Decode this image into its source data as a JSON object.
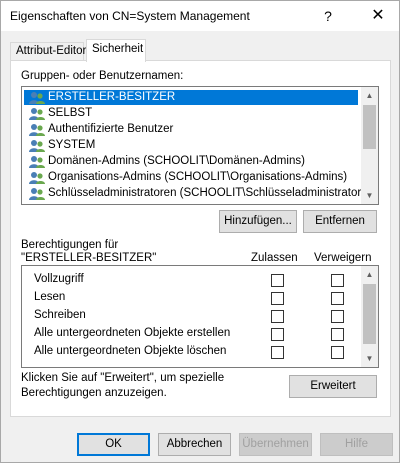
{
  "window": {
    "title": "Eigenschaften von CN=System Management",
    "help_symbol": "?",
    "close_symbol": "✕"
  },
  "tabs": [
    {
      "label": "Attribut-Editor"
    },
    {
      "label": "Sicherheit"
    }
  ],
  "groups": {
    "label": "Gruppen- oder Benutzernamen:",
    "items": [
      {
        "label": "ERSTELLER-BESITZER",
        "selected": true
      },
      {
        "label": "SELBST"
      },
      {
        "label": "Authentifizierte Benutzer"
      },
      {
        "label": "SYSTEM"
      },
      {
        "label": "Domänen-Admins (SCHOOLIT\\Domänen-Admins)"
      },
      {
        "label": "Organisations-Admins (SCHOOLIT\\Organisations-Admins)"
      },
      {
        "label": "Schlüsseladministratoren (SCHOOLIT\\Schlüsseladministratoren)"
      }
    ],
    "add_button": "Hinzufügen...",
    "remove_button": "Entfernen"
  },
  "permissions": {
    "heading_line1": "Berechtigungen für",
    "heading_line2": "\"ERSTELLER-BESITZER\"",
    "allow_header": "Zulassen",
    "deny_header": "Verweigern",
    "rows": [
      {
        "label": "Vollzugriff",
        "allow": false,
        "deny": false
      },
      {
        "label": "Lesen",
        "allow": false,
        "deny": false
      },
      {
        "label": "Schreiben",
        "allow": false,
        "deny": false
      },
      {
        "label": "Alle untergeordneten Objekte erstellen",
        "allow": false,
        "deny": false
      },
      {
        "label": "Alle untergeordneten Objekte löschen",
        "allow": false,
        "deny": false
      }
    ]
  },
  "advanced": {
    "hint_line1": "Klicken Sie auf \"Erweitert\", um spezielle",
    "hint_line2": "Berechtigungen anzuzeigen.",
    "button": "Erweitert"
  },
  "footer": {
    "ok": "OK",
    "cancel": "Abbrechen",
    "apply": "Übernehmen",
    "help": "Hilfe"
  },
  "colors": {
    "selection": "#0078d7",
    "default_button_border": "#0078d7"
  },
  "icons": {
    "user": "users-group-icon"
  }
}
